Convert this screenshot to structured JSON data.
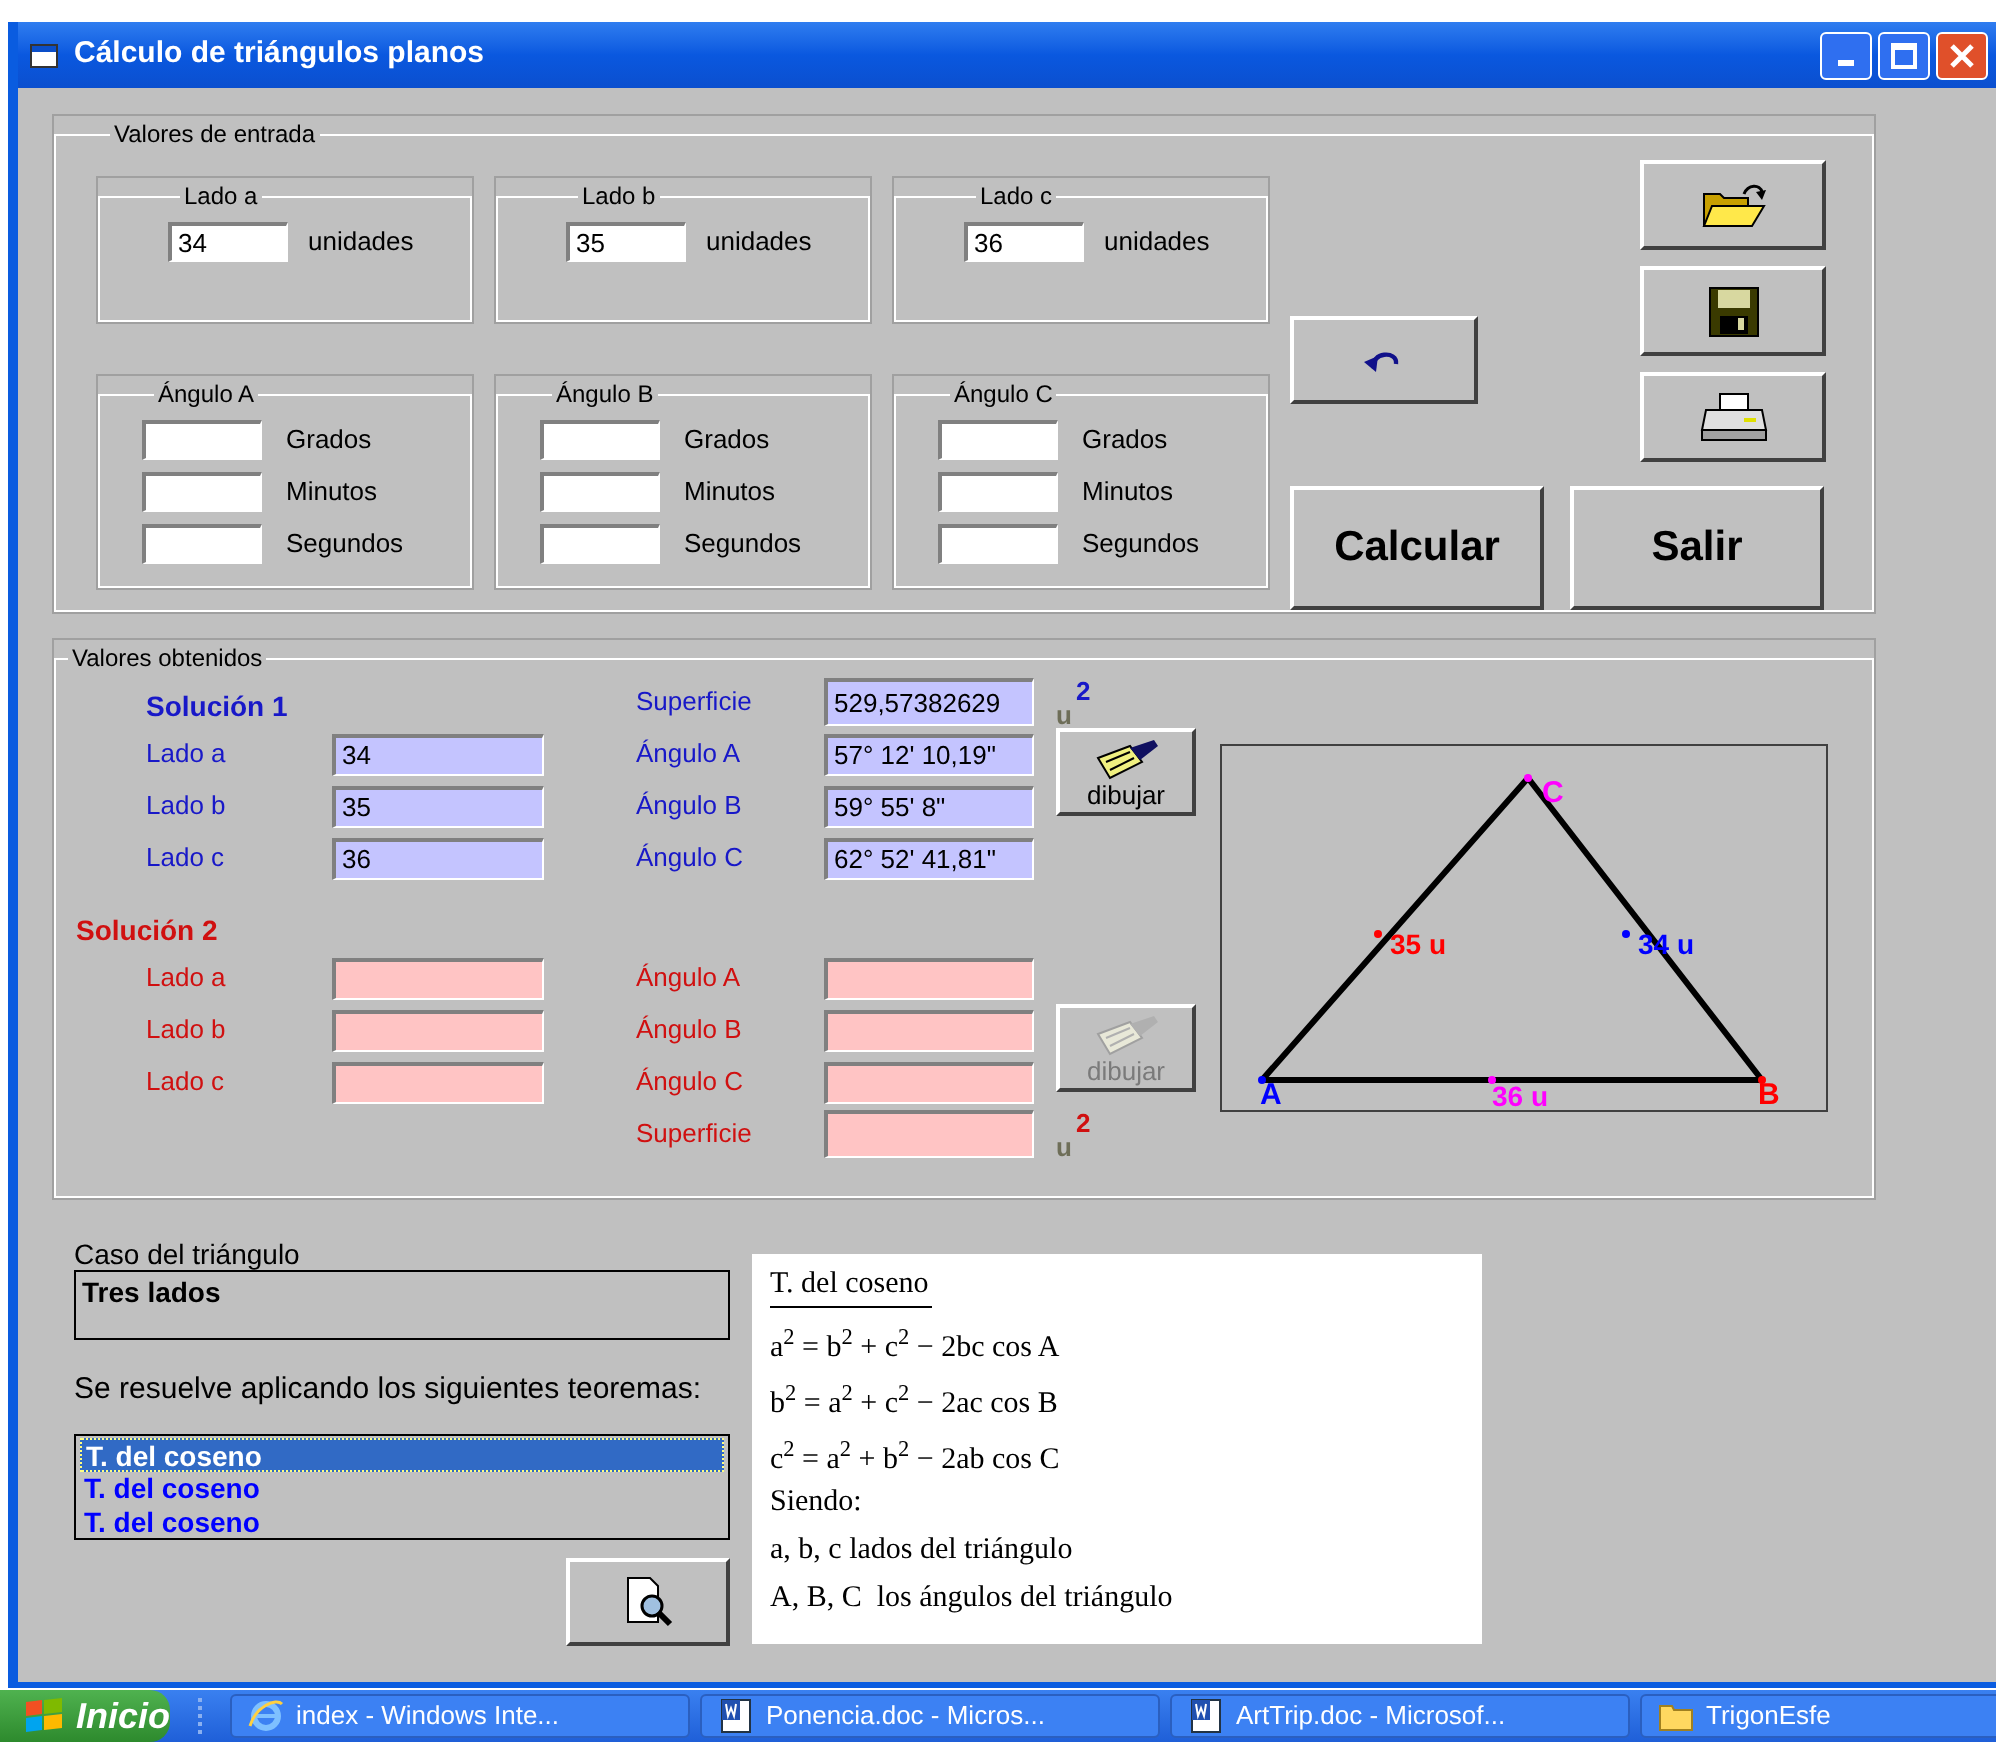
{
  "window": {
    "title": "Cálculo de triángulos planos"
  },
  "entrada": {
    "title": "Valores de entrada",
    "sides": [
      {
        "label": "Lado a",
        "value": "34",
        "unit": "unidades"
      },
      {
        "label": "Lado b",
        "value": "35",
        "unit": "unidades"
      },
      {
        "label": "Lado c",
        "value": "36",
        "unit": "unidades"
      }
    ],
    "angles": [
      {
        "label": "Ángulo A",
        "fields": [
          "Grados",
          "Minutos",
          "Segundos"
        ]
      },
      {
        "label": "Ángulo B",
        "fields": [
          "Grados",
          "Minutos",
          "Segundos"
        ]
      },
      {
        "label": "Ángulo C",
        "fields": [
          "Grados",
          "Minutos",
          "Segundos"
        ]
      }
    ],
    "buttons": [
      {
        "label": "Calcular"
      },
      {
        "label": "Salir"
      }
    ]
  },
  "obtenidos": {
    "title": "Valores obtenidos",
    "solutions": [
      {
        "kind": "first",
        "title": "Solución 1",
        "sides": [
          {
            "label": "Lado a",
            "value": "34"
          },
          {
            "label": "Lado b",
            "value": "35"
          },
          {
            "label": "Lado c",
            "value": "36"
          }
        ],
        "angles": [
          {
            "label": "Ángulo A",
            "value": "57° 12' 10,19\""
          },
          {
            "label": "Ángulo B",
            "value": "59° 55' 8\""
          },
          {
            "label": "Ángulo C",
            "value": "62° 52' 41,81\""
          }
        ],
        "area": {
          "label": "Superficie",
          "value": "529,57382629",
          "unit": "u",
          "exponent": "2"
        },
        "draw_button": {
          "label": "dibujar",
          "disabled": false
        }
      },
      {
        "kind": "second",
        "title": "Solución 2",
        "sides": [
          {
            "label": "Lado a"
          },
          {
            "label": "Lado b"
          },
          {
            "label": "Lado c"
          }
        ],
        "angles": [
          {
            "label": "Ángulo A"
          },
          {
            "label": "Ángulo B"
          },
          {
            "label": "Ángulo C"
          }
        ],
        "area": {
          "label": "Superficie",
          "unit": "u",
          "exponent": "2"
        },
        "draw_button": {
          "label": "dibujar",
          "disabled": true
        }
      }
    ],
    "triangle": {
      "vertices": [
        "A",
        "B",
        "C"
      ],
      "sides": [
        "35 u",
        "34 u",
        "36 u"
      ]
    }
  },
  "caso": {
    "label": "Caso del triángulo",
    "value": "Tres lados"
  },
  "teoremas": {
    "label": "Se resuelve aplicando los siguientes teoremas:",
    "items": [
      {
        "label": "T. del coseno",
        "selected": true
      },
      {
        "label": "T. del coseno",
        "selected": false
      },
      {
        "label": "T. del coseno",
        "selected": false
      }
    ]
  },
  "panel": {
    "title": "T. del coseno",
    "formulas": [
      "a$^{2}$ = b$^{2}$ + c$^{2}$ − 2bc cos A",
      "b$^{2}$ = a$^{2}$ + c$^{2}$ − 2ac cos B",
      "c$^{2}$ = a$^{2}$ + b$^{2}$ − 2ab cos C"
    ],
    "lines": [
      "Siendo:",
      "a, b, c lados del triángulo",
      "A, B, C  los ángulos del triángulo"
    ]
  },
  "taskbar": {
    "start": "Inicio",
    "items": [
      {
        "kind": "browser",
        "label": "index - Windows Inte..."
      },
      {
        "kind": "document",
        "label": "Ponencia.doc - Micros..."
      },
      {
        "kind": "document",
        "label": "ArtTrip.doc - Microsof..."
      },
      {
        "kind": "folder",
        "label": "TrigonEsfe"
      }
    ]
  }
}
